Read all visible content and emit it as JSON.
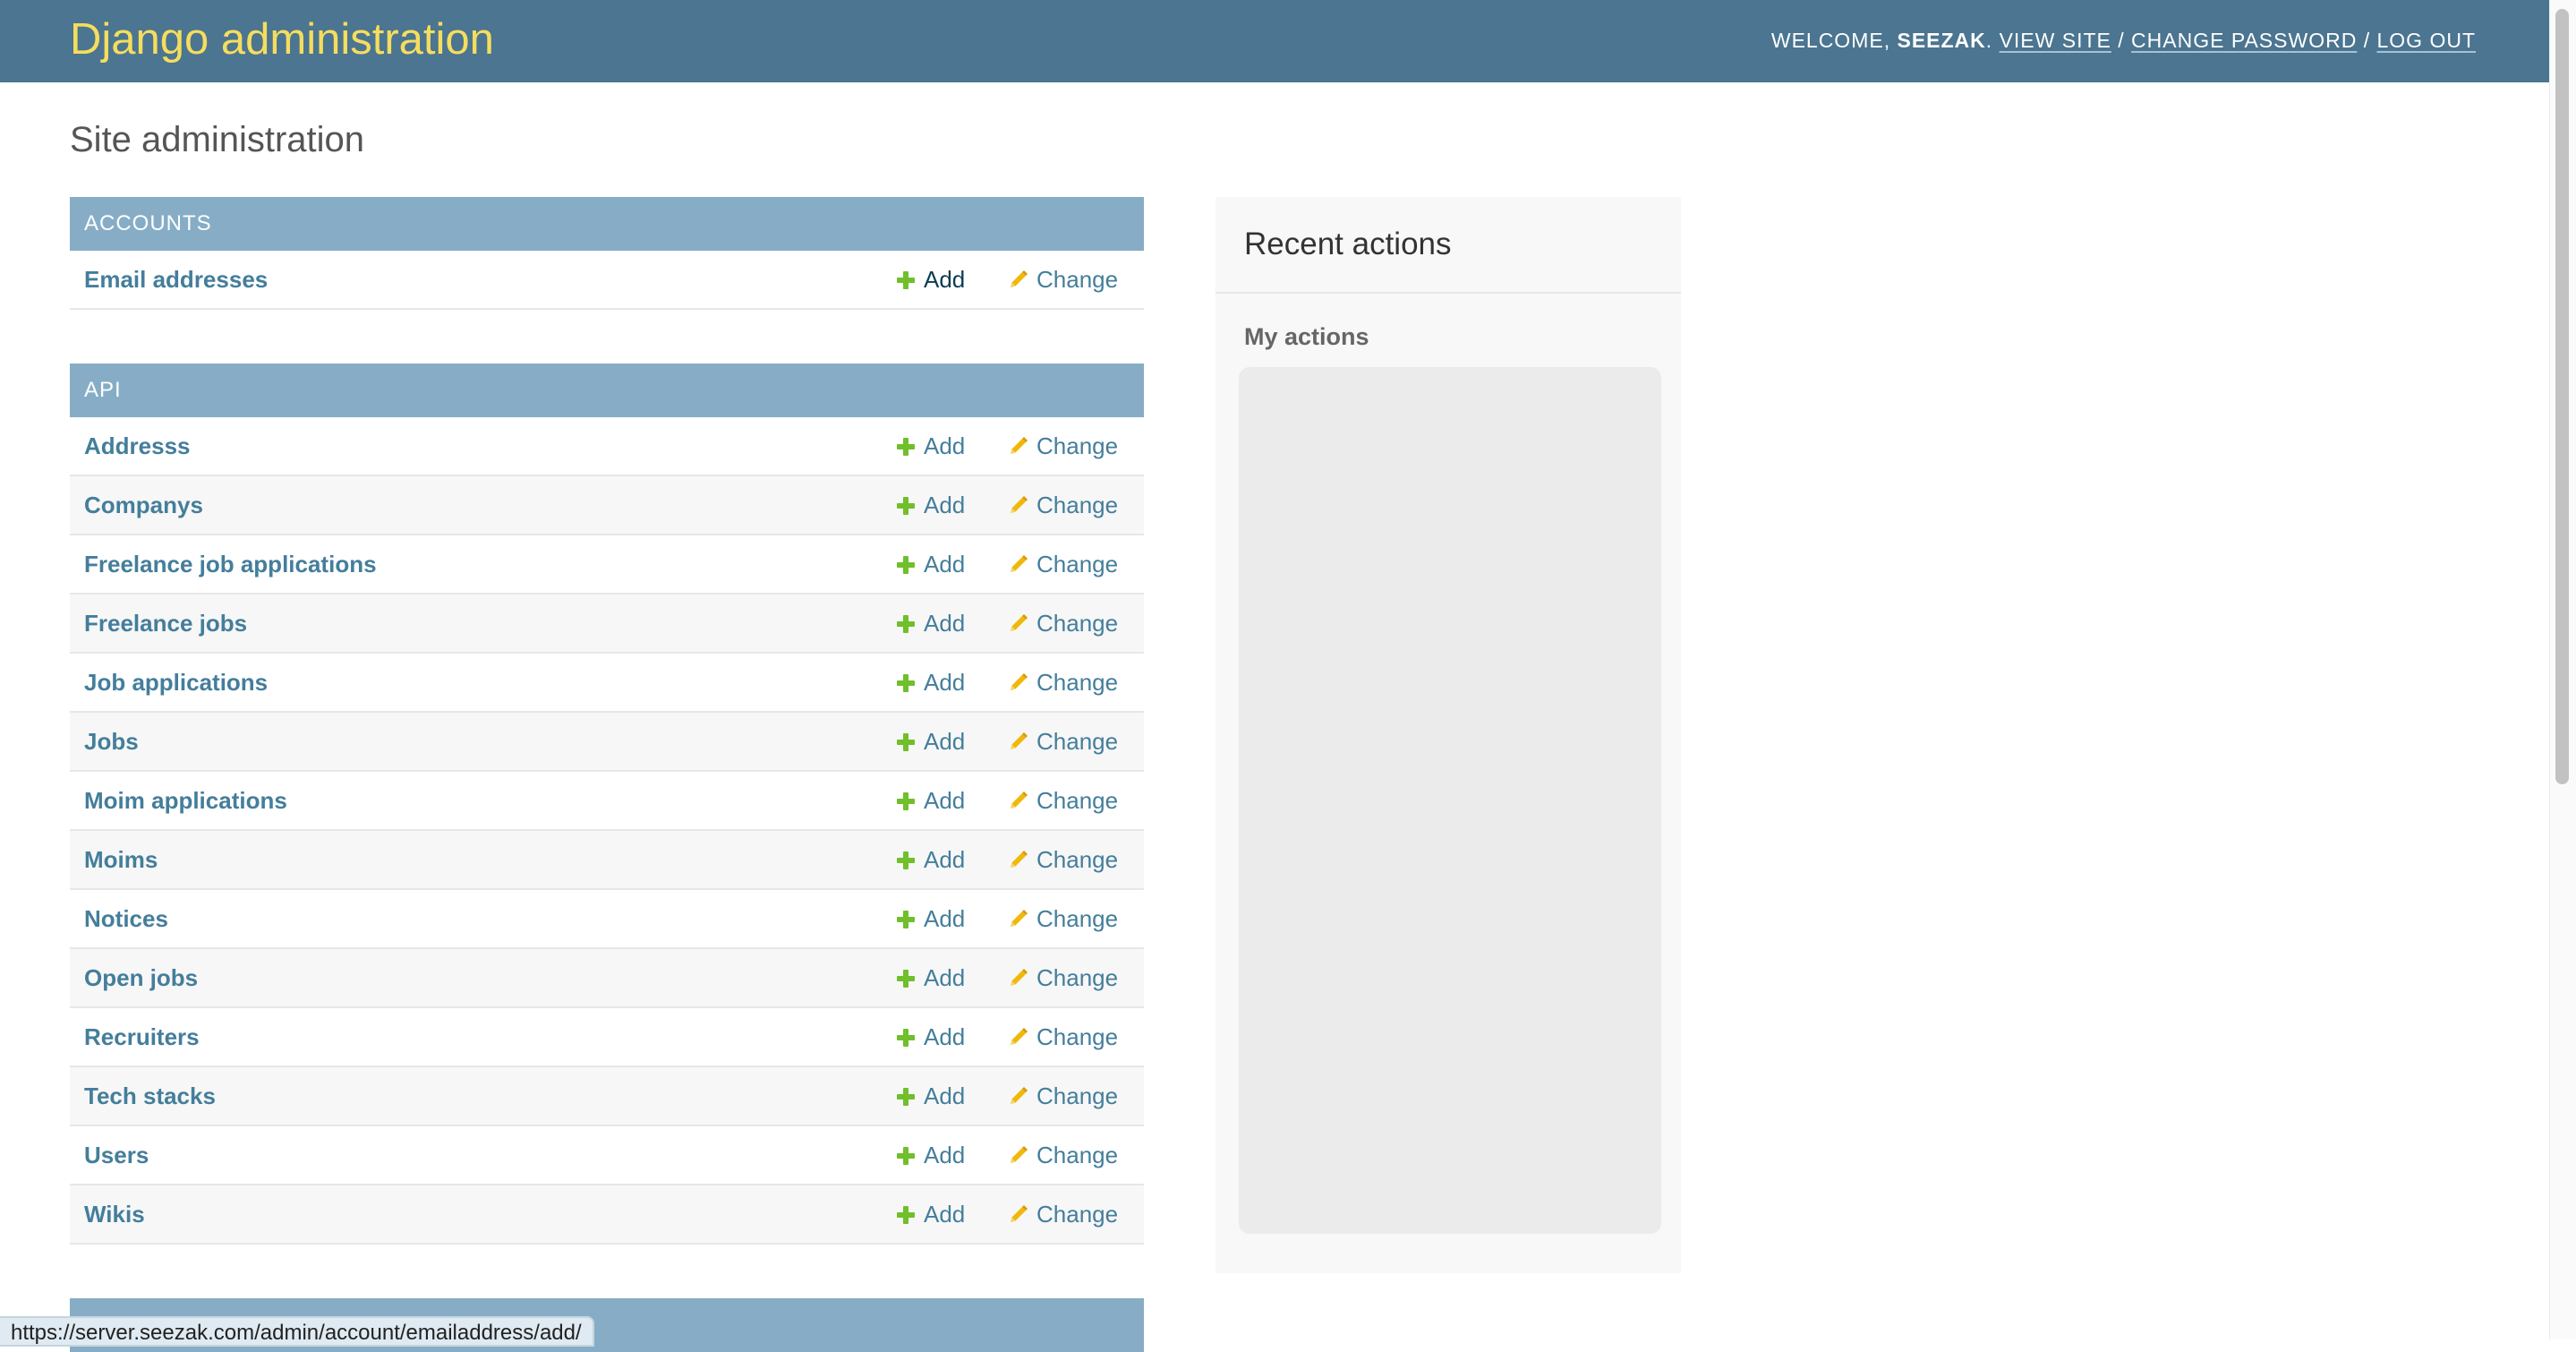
{
  "header": {
    "branding": "Django administration",
    "welcome": "Welcome, ",
    "username": "seezak",
    "period": ".",
    "view_site": "View site",
    "change_password": "Change password",
    "log_out": "Log out",
    "sep": " / "
  },
  "page_title": "Site administration",
  "modules": [
    {
      "caption": "Accounts",
      "models": [
        {
          "name": "Email addresses",
          "add": "Add",
          "change": "Change"
        }
      ]
    },
    {
      "caption": "API",
      "models": [
        {
          "name": "Addresss",
          "add": "Add",
          "change": "Change"
        },
        {
          "name": "Companys",
          "add": "Add",
          "change": "Change"
        },
        {
          "name": "Freelance job applications",
          "add": "Add",
          "change": "Change"
        },
        {
          "name": "Freelance jobs",
          "add": "Add",
          "change": "Change"
        },
        {
          "name": "Job applications",
          "add": "Add",
          "change": "Change"
        },
        {
          "name": "Jobs",
          "add": "Add",
          "change": "Change"
        },
        {
          "name": "Moim applications",
          "add": "Add",
          "change": "Change"
        },
        {
          "name": "Moims",
          "add": "Add",
          "change": "Change"
        },
        {
          "name": "Notices",
          "add": "Add",
          "change": "Change"
        },
        {
          "name": "Open jobs",
          "add": "Add",
          "change": "Change"
        },
        {
          "name": "Recruiters",
          "add": "Add",
          "change": "Change"
        },
        {
          "name": "Tech stacks",
          "add": "Add",
          "change": "Change"
        },
        {
          "name": "Users",
          "add": "Add",
          "change": "Change"
        },
        {
          "name": "Wikis",
          "add": "Add",
          "change": "Change"
        }
      ]
    }
  ],
  "sidebar": {
    "title": "Recent actions",
    "my_actions": "My actions"
  },
  "status_bar": {
    "url": "https://server.seezak.com/admin/account/emailaddress/add/"
  },
  "colors": {
    "header_bg": "#4b7590",
    "branding": "#f5dd5d",
    "caption_bg": "#86adc5",
    "link": "#447e9b",
    "add_icon": "#70bf2b",
    "change_icon": "#efb80b"
  },
  "icons": {
    "add": "plus-icon",
    "change": "pencil-icon"
  }
}
